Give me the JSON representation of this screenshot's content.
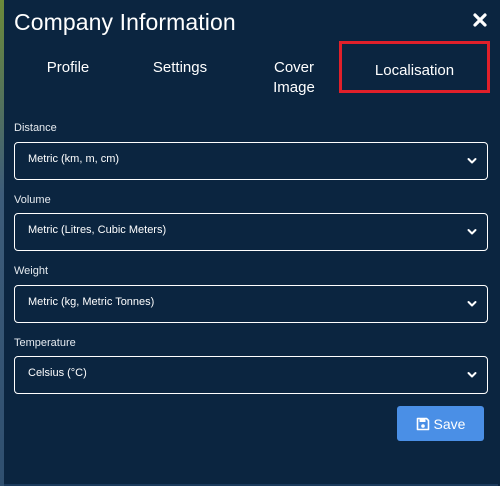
{
  "modal": {
    "title": "Company Information",
    "close_icon": "close-icon"
  },
  "tabs": [
    {
      "label": "Profile"
    },
    {
      "label": "Settings"
    },
    {
      "label_line1": "Cover",
      "label_line2": "Image"
    },
    {
      "label": "Localisation",
      "active": true
    }
  ],
  "fields": {
    "distance": {
      "label": "Distance",
      "value": "Metric (km, m, cm)"
    },
    "volume": {
      "label": "Volume",
      "value": "Metric (Litres, Cubic Meters)"
    },
    "weight": {
      "label": "Weight",
      "value": "Metric (kg, Metric Tonnes)"
    },
    "temperature": {
      "label": "Temperature",
      "value": "Celsius (°C)"
    }
  },
  "save_button": {
    "label": "Save",
    "icon": "floppy-disk-icon"
  },
  "colors": {
    "background": "#0b2540",
    "accent": "#4a8fe6",
    "highlight": "#e0202a",
    "text": "#ffffff"
  }
}
